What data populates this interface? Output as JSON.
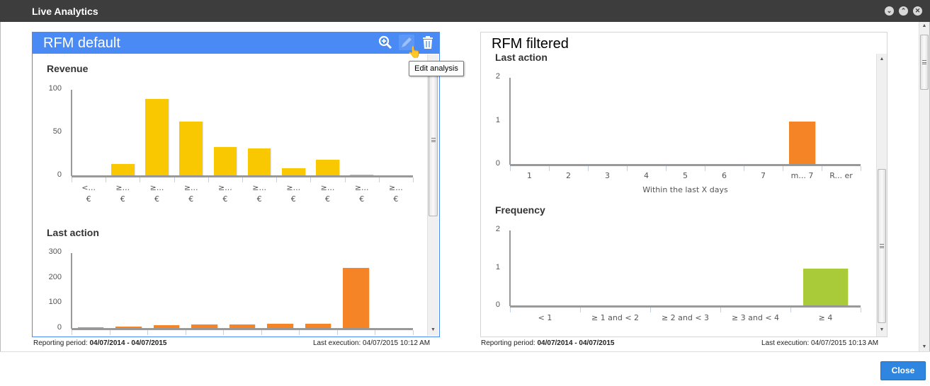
{
  "window": {
    "title": "Live Analytics",
    "controls": [
      "minimize-icon",
      "maximize-icon",
      "close-icon"
    ]
  },
  "footer": {
    "close_label": "Close"
  },
  "colors": {
    "header": "#4a8af4",
    "revenue": "#f9c800",
    "last_action": "#f58426",
    "frequency": "#a9cb3a",
    "close_button": "#2f86e0"
  },
  "left_panel": {
    "title": "RFM default",
    "tooltip": "Edit analysis",
    "reporting_label": "Reporting period:",
    "reporting_value": "04/07/2014 - 04/07/2015",
    "execution_label": "Last execution:",
    "execution_value": "04/07/2015 10:12 AM"
  },
  "right_panel": {
    "title": "RFM filtered",
    "reporting_label": "Reporting period:",
    "reporting_value": "04/07/2014 - 04/07/2015",
    "execution_label": "Last execution:",
    "execution_value": "04/07/2015 10:13 AM"
  },
  "chart_data": [
    {
      "id": "revenue",
      "type": "bar",
      "title": "Revenue",
      "categories": [
        "<... €",
        "≥... €",
        "≥... €",
        "≥... €",
        "≥... €",
        "≥... €",
        "≥... €",
        "≥... €",
        "≥... €",
        "≥... €"
      ],
      "values": [
        0,
        14,
        89,
        63,
        34,
        32,
        9,
        19,
        2,
        0
      ],
      "ylim": [
        0,
        100
      ],
      "yticks": [
        0,
        50,
        100
      ],
      "xlabel": "",
      "color": "#f9c800"
    },
    {
      "id": "last_action_default",
      "type": "bar",
      "title": "Last action",
      "categories": [
        "",
        "",
        "",
        "",
        "",
        "",
        "",
        "",
        ""
      ],
      "values": [
        5,
        8,
        13,
        16,
        16,
        19,
        19,
        240,
        0
      ],
      "ylim": [
        0,
        300
      ],
      "yticks": [
        0,
        100,
        200,
        300
      ],
      "xlabel": "",
      "color": "#f58426"
    },
    {
      "id": "last_action_filtered",
      "type": "bar",
      "title": "Last action",
      "categories": [
        "1",
        "2",
        "3",
        "4",
        "5",
        "6",
        "7",
        "m... 7",
        "R... er"
      ],
      "values": [
        0,
        0,
        0,
        0,
        0,
        0,
        0,
        1,
        0
      ],
      "ylim": [
        0,
        2
      ],
      "yticks": [
        0,
        1,
        2
      ],
      "xlabel": "Within the last X days",
      "color": "#f58426"
    },
    {
      "id": "frequency",
      "type": "bar",
      "title": "Frequency",
      "categories": [
        "< 1",
        "≥ 1 and < 2",
        "≥ 2 and < 3",
        "≥ 3 and < 4",
        "≥ 4"
      ],
      "values": [
        0,
        0,
        0,
        0,
        1
      ],
      "ylim": [
        0,
        2
      ],
      "yticks": [
        0,
        1,
        2
      ],
      "xlabel": "",
      "color": "#a9cb3a"
    }
  ]
}
